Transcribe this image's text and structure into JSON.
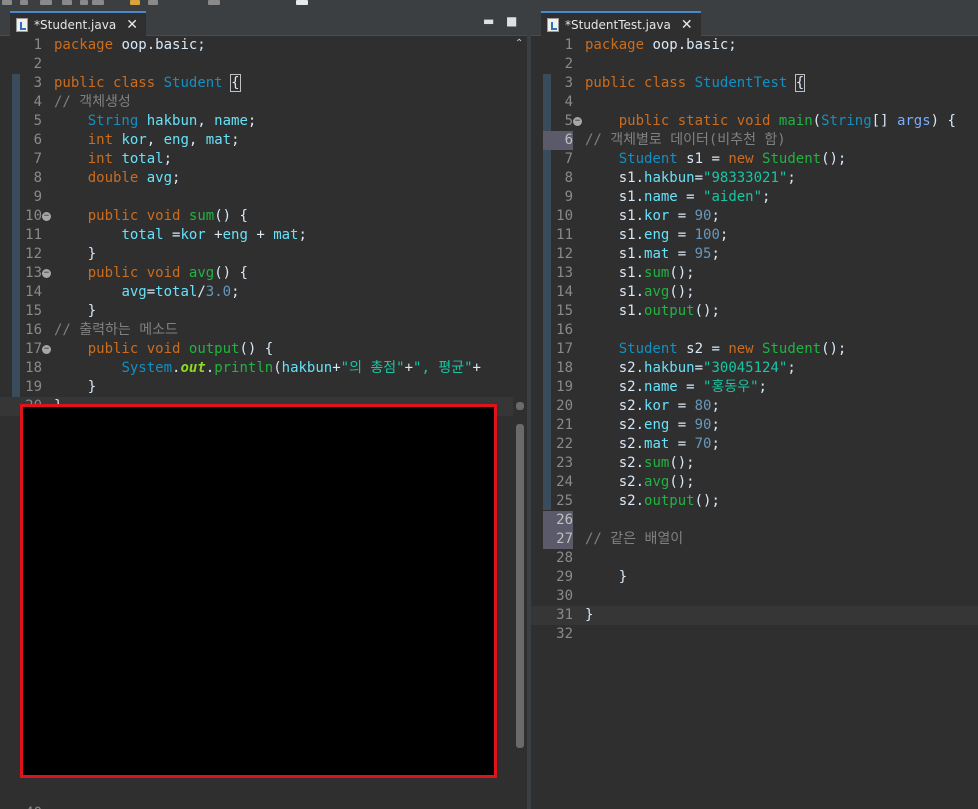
{
  "colors": {
    "accent": "#4a88c7",
    "redaction_border": "#e0131b",
    "redaction_fill": "#000000"
  },
  "left_editor": {
    "tab": {
      "icon": "java-file-icon",
      "title": "*Student.java",
      "close_glyph": "✕"
    },
    "minimize_glyph": "▬",
    "maximize_glyph": "■",
    "last_line_number": "40",
    "lines": [
      {
        "n": "1",
        "tokens": [
          [
            "kw",
            "package"
          ],
          [
            "plain",
            " oop.basic;"
          ]
        ]
      },
      {
        "n": "2",
        "tokens": []
      },
      {
        "n": "3",
        "tokens": [
          [
            "kw",
            "public"
          ],
          [
            "plain",
            " "
          ],
          [
            "kw",
            "class"
          ],
          [
            "plain",
            " "
          ],
          [
            "typ",
            "Student"
          ],
          [
            "plain",
            " "
          ],
          [
            "box",
            "{"
          ]
        ]
      },
      {
        "n": "4",
        "tokens": [
          [
            "cmt",
            "// 객체생성"
          ]
        ]
      },
      {
        "n": "5",
        "tokens": [
          [
            "plain",
            "    "
          ],
          [
            "typ",
            "String"
          ],
          [
            "plain",
            " "
          ],
          [
            "fld",
            "hakbun"
          ],
          [
            "plain",
            ", "
          ],
          [
            "fld",
            "name"
          ],
          [
            "plain",
            ";"
          ]
        ]
      },
      {
        "n": "6",
        "tokens": [
          [
            "plain",
            "    "
          ],
          [
            "kw",
            "int"
          ],
          [
            "plain",
            " "
          ],
          [
            "fld",
            "kor"
          ],
          [
            "plain",
            ", "
          ],
          [
            "fld",
            "eng"
          ],
          [
            "plain",
            ", "
          ],
          [
            "fld",
            "mat"
          ],
          [
            "plain",
            ";"
          ]
        ]
      },
      {
        "n": "7",
        "tokens": [
          [
            "plain",
            "    "
          ],
          [
            "kw",
            "int"
          ],
          [
            "plain",
            " "
          ],
          [
            "fld",
            "total"
          ],
          [
            "plain",
            ";"
          ]
        ]
      },
      {
        "n": "8",
        "tokens": [
          [
            "plain",
            "    "
          ],
          [
            "kw",
            "double"
          ],
          [
            "plain",
            " "
          ],
          [
            "fld",
            "avg"
          ],
          [
            "plain",
            ";"
          ]
        ]
      },
      {
        "n": "9",
        "tokens": []
      },
      {
        "n": "10",
        "fold": true,
        "tokens": [
          [
            "plain",
            "    "
          ],
          [
            "kw",
            "public"
          ],
          [
            "plain",
            " "
          ],
          [
            "kw",
            "void"
          ],
          [
            "plain",
            " "
          ],
          [
            "fn",
            "sum"
          ],
          [
            "plain",
            "() {"
          ]
        ]
      },
      {
        "n": "11",
        "tokens": [
          [
            "plain",
            "        "
          ],
          [
            "fld",
            "total"
          ],
          [
            "plain",
            " ="
          ],
          [
            "fld",
            "kor"
          ],
          [
            "plain",
            " +"
          ],
          [
            "fld",
            "eng"
          ],
          [
            "plain",
            " + "
          ],
          [
            "fld",
            "mat"
          ],
          [
            "plain",
            ";"
          ]
        ]
      },
      {
        "n": "12",
        "tokens": [
          [
            "plain",
            "    }"
          ]
        ]
      },
      {
        "n": "13",
        "fold": true,
        "tokens": [
          [
            "plain",
            "    "
          ],
          [
            "kw",
            "public"
          ],
          [
            "plain",
            " "
          ],
          [
            "kw",
            "void"
          ],
          [
            "plain",
            " "
          ],
          [
            "fn",
            "avg"
          ],
          [
            "plain",
            "() {"
          ]
        ]
      },
      {
        "n": "14",
        "tokens": [
          [
            "plain",
            "        "
          ],
          [
            "fld",
            "avg"
          ],
          [
            "plain",
            "="
          ],
          [
            "fld",
            "total"
          ],
          [
            "plain",
            "/"
          ],
          [
            "num",
            "3.0"
          ],
          [
            "plain",
            ";"
          ]
        ]
      },
      {
        "n": "15",
        "tokens": [
          [
            "plain",
            "    }"
          ]
        ]
      },
      {
        "n": "16",
        "tokens": [
          [
            "cmt",
            "// 출력하는 메소드"
          ]
        ]
      },
      {
        "n": "17",
        "fold": true,
        "tokens": [
          [
            "plain",
            "    "
          ],
          [
            "kw",
            "public"
          ],
          [
            "plain",
            " "
          ],
          [
            "kw",
            "void"
          ],
          [
            "plain",
            " "
          ],
          [
            "fn",
            "output"
          ],
          [
            "plain",
            "() {"
          ]
        ]
      },
      {
        "n": "18",
        "tokens": [
          [
            "plain",
            "        "
          ],
          [
            "typ",
            "System"
          ],
          [
            "plain",
            "."
          ],
          [
            "out",
            "out"
          ],
          [
            "plain",
            "."
          ],
          [
            "fn",
            "println"
          ],
          [
            "plain",
            "("
          ],
          [
            "fld",
            "hakbun"
          ],
          [
            "plain",
            "+"
          ],
          [
            "str",
            "\"의 총점\""
          ],
          [
            "plain",
            "+"
          ],
          [
            "str",
            "\", 평균\""
          ],
          [
            "plain",
            "+"
          ]
        ]
      },
      {
        "n": "19",
        "tokens": [
          [
            "plain",
            "    }"
          ]
        ]
      },
      {
        "n": "20",
        "current": true,
        "tokens": [
          [
            "plain",
            "}"
          ]
        ]
      }
    ]
  },
  "right_editor": {
    "tab": {
      "icon": "java-file-icon",
      "title": "*StudentTest.java",
      "close_glyph": "✕"
    },
    "lines": [
      {
        "n": "1",
        "tokens": [
          [
            "kw",
            "package"
          ],
          [
            "plain",
            " oop.basic;"
          ]
        ]
      },
      {
        "n": "2",
        "tokens": []
      },
      {
        "n": "3",
        "tokens": [
          [
            "kw",
            "public"
          ],
          [
            "plain",
            " "
          ],
          [
            "kw",
            "class"
          ],
          [
            "plain",
            " "
          ],
          [
            "typ",
            "StudentTest"
          ],
          [
            "plain",
            " "
          ],
          [
            "box",
            "{"
          ]
        ]
      },
      {
        "n": "4",
        "tokens": []
      },
      {
        "n": "5",
        "fold": true,
        "tokens": [
          [
            "plain",
            "    "
          ],
          [
            "kw",
            "public"
          ],
          [
            "plain",
            " "
          ],
          [
            "kw",
            "static"
          ],
          [
            "plain",
            " "
          ],
          [
            "kw",
            "void"
          ],
          [
            "plain",
            " "
          ],
          [
            "fn",
            "main"
          ],
          [
            "plain",
            "("
          ],
          [
            "typ",
            "String"
          ],
          [
            "plain",
            "[] "
          ],
          [
            "par",
            "args"
          ],
          [
            "plain",
            ") {"
          ]
        ]
      },
      {
        "n": "6",
        "hl": true,
        "tokens": [
          [
            "cmt",
            "// 객체별로 데이터(비추천 함)"
          ]
        ]
      },
      {
        "n": "7",
        "tokens": [
          [
            "plain",
            "    "
          ],
          [
            "typ",
            "Student"
          ],
          [
            "plain",
            " s1 = "
          ],
          [
            "kw",
            "new"
          ],
          [
            "plain",
            " "
          ],
          [
            "fn",
            "Student"
          ],
          [
            "plain",
            "();"
          ]
        ]
      },
      {
        "n": "8",
        "tokens": [
          [
            "plain",
            "    s1."
          ],
          [
            "fld",
            "hakbun"
          ],
          [
            "plain",
            "="
          ],
          [
            "str",
            "\"98333021\""
          ],
          [
            "plain",
            ";"
          ]
        ]
      },
      {
        "n": "9",
        "tokens": [
          [
            "plain",
            "    s1."
          ],
          [
            "fld",
            "name"
          ],
          [
            "plain",
            " = "
          ],
          [
            "str",
            "\"aiden\""
          ],
          [
            "plain",
            ";"
          ]
        ]
      },
      {
        "n": "10",
        "tokens": [
          [
            "plain",
            "    s1."
          ],
          [
            "fld",
            "kor"
          ],
          [
            "plain",
            " = "
          ],
          [
            "num",
            "90"
          ],
          [
            "plain",
            ";"
          ]
        ]
      },
      {
        "n": "11",
        "tokens": [
          [
            "plain",
            "    s1."
          ],
          [
            "fld",
            "eng"
          ],
          [
            "plain",
            " = "
          ],
          [
            "num",
            "100"
          ],
          [
            "plain",
            ";"
          ]
        ]
      },
      {
        "n": "12",
        "tokens": [
          [
            "plain",
            "    s1."
          ],
          [
            "fld",
            "mat"
          ],
          [
            "plain",
            " = "
          ],
          [
            "num",
            "95"
          ],
          [
            "plain",
            ";"
          ]
        ]
      },
      {
        "n": "13",
        "tokens": [
          [
            "plain",
            "    s1."
          ],
          [
            "fn",
            "sum"
          ],
          [
            "plain",
            "();"
          ]
        ]
      },
      {
        "n": "14",
        "tokens": [
          [
            "plain",
            "    s1."
          ],
          [
            "fn",
            "avg"
          ],
          [
            "plain",
            "();"
          ]
        ]
      },
      {
        "n": "15",
        "tokens": [
          [
            "plain",
            "    s1."
          ],
          [
            "fn",
            "output"
          ],
          [
            "plain",
            "();"
          ]
        ]
      },
      {
        "n": "16",
        "tokens": []
      },
      {
        "n": "17",
        "tokens": [
          [
            "plain",
            "    "
          ],
          [
            "typ",
            "Student"
          ],
          [
            "plain",
            " s2 = "
          ],
          [
            "kw",
            "new"
          ],
          [
            "plain",
            " "
          ],
          [
            "fn",
            "Student"
          ],
          [
            "plain",
            "();"
          ]
        ]
      },
      {
        "n": "18",
        "tokens": [
          [
            "plain",
            "    s2."
          ],
          [
            "fld",
            "hakbun"
          ],
          [
            "plain",
            "="
          ],
          [
            "str",
            "\"30045124\""
          ],
          [
            "plain",
            ";"
          ]
        ]
      },
      {
        "n": "19",
        "tokens": [
          [
            "plain",
            "    s2."
          ],
          [
            "fld",
            "name"
          ],
          [
            "plain",
            " = "
          ],
          [
            "str",
            "\"홍동우\""
          ],
          [
            "plain",
            ";"
          ]
        ]
      },
      {
        "n": "20",
        "tokens": [
          [
            "plain",
            "    s2."
          ],
          [
            "fld",
            "kor"
          ],
          [
            "plain",
            " = "
          ],
          [
            "num",
            "80"
          ],
          [
            "plain",
            ";"
          ]
        ]
      },
      {
        "n": "21",
        "tokens": [
          [
            "plain",
            "    s2."
          ],
          [
            "fld",
            "eng"
          ],
          [
            "plain",
            " = "
          ],
          [
            "num",
            "90"
          ],
          [
            "plain",
            ";"
          ]
        ]
      },
      {
        "n": "22",
        "tokens": [
          [
            "plain",
            "    s2."
          ],
          [
            "fld",
            "mat"
          ],
          [
            "plain",
            " = "
          ],
          [
            "num",
            "70"
          ],
          [
            "plain",
            ";"
          ]
        ]
      },
      {
        "n": "23",
        "tokens": [
          [
            "plain",
            "    s2."
          ],
          [
            "fn",
            "sum"
          ],
          [
            "plain",
            "();"
          ]
        ]
      },
      {
        "n": "24",
        "tokens": [
          [
            "plain",
            "    s2."
          ],
          [
            "fn",
            "avg"
          ],
          [
            "plain",
            "();"
          ]
        ]
      },
      {
        "n": "25",
        "tokens": [
          [
            "plain",
            "    s2."
          ],
          [
            "fn",
            "output"
          ],
          [
            "plain",
            "();"
          ]
        ]
      },
      {
        "n": "26",
        "hl": true,
        "tokens": []
      },
      {
        "n": "27",
        "hl": true,
        "tokens": [
          [
            "cmt",
            "// 같은 배열이"
          ]
        ]
      },
      {
        "n": "28",
        "tokens": []
      },
      {
        "n": "29",
        "tokens": [
          [
            "plain",
            "    }"
          ]
        ]
      },
      {
        "n": "30",
        "tokens": []
      },
      {
        "n": "31",
        "current": true,
        "tokens": [
          [
            "plain",
            "}"
          ]
        ]
      },
      {
        "n": "32",
        "tokens": []
      }
    ]
  }
}
